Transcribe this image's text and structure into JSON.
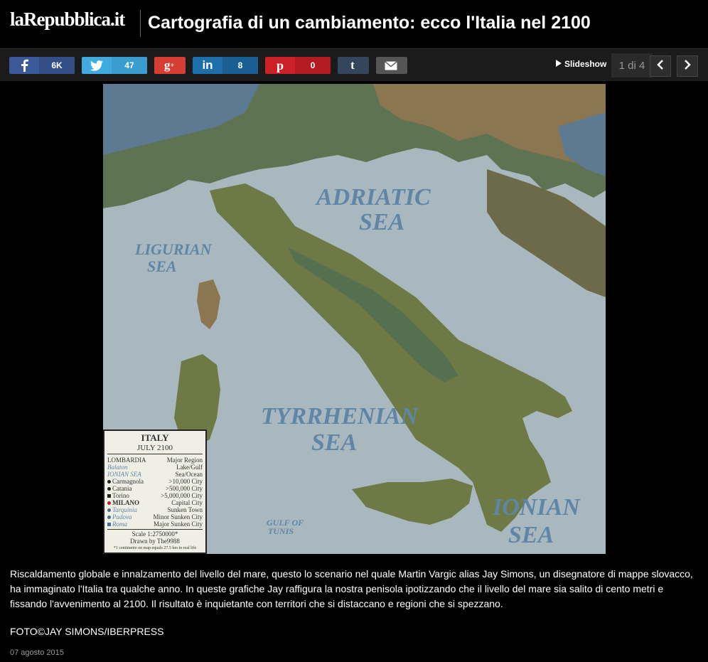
{
  "header": {
    "logo": "laRepubblica.it",
    "title": "Cartografia di un cambiamento: ecco l'Italia nel 2100"
  },
  "share": {
    "facebook": {
      "icon": "facebook-icon",
      "count": "6K"
    },
    "twitter": {
      "icon": "twitter-icon",
      "count": "47"
    },
    "googleplus": {
      "icon": "google-plus-icon"
    },
    "linkedin": {
      "icon": "linkedin-icon",
      "count": "8"
    },
    "pinterest": {
      "icon": "pinterest-icon",
      "count": "0"
    },
    "tumblr": {
      "icon": "tumblr-icon"
    },
    "email": {
      "icon": "email-icon"
    }
  },
  "gallery": {
    "slideshow_label": "Slideshow",
    "position": "1 di 4"
  },
  "map": {
    "sea_labels": [
      "ADRIATIC",
      "SEA",
      "LIGURIAN",
      "SEA",
      "TYRRHENIAN",
      "SEA",
      "IONIAN",
      "SEA",
      "GULF OF",
      "TUNIS"
    ],
    "legend": {
      "title": "ITALY",
      "subtitle": "JULY 2100",
      "rows": [
        {
          "left": "LOMBARDIA",
          "right": "Major Region"
        },
        {
          "left": "Balaton",
          "right": "Lake/Gulf"
        },
        {
          "left": "IONIAN SEA",
          "right": "Sea/Ocean"
        },
        {
          "left": "Carmagnola",
          "right": ">10,000 City"
        },
        {
          "left": "Catania",
          "right": ">500,000 City"
        },
        {
          "left": "Torino",
          "right": ">5,000,000 City"
        },
        {
          "left": "MILANO",
          "right": "Capital City"
        },
        {
          "left": "Tarquinia",
          "right": "Sunken Town"
        },
        {
          "left": "Padova",
          "right": "Minor Sunken City"
        },
        {
          "left": "Roma",
          "right": "Major Sunken City"
        }
      ],
      "scale": "Scale 1:2750000*",
      "drawn_by": "Drawn by The9988",
      "note": "*1 centimetre on map equals 27.5 km in real life"
    },
    "colors": {
      "sea": "#a9b8bf",
      "land_olive": "#6e7a45",
      "land_green": "#56704f",
      "land_brown": "#8a7650",
      "land_blue": "#5d7a93"
    }
  },
  "article": {
    "description": "Riscaldamento globale e innalzamento del livello del mare, questo lo scenario nel quale Martin Vargic alias Jay Simons, un disegnatore di mappe slovacco, ha immaginato l'Italia tra qualche anno. In queste grafiche Jay raffigura la nostra penisola ipotizzando che il livello del mare sia salito di cento metri e  fissando l'avvenimento al 2100. Il risultato è inquietante con territori che si distaccano e regioni che si spezzano.",
    "credit": "FOTO©JAY SIMONS/IBERPRESS",
    "date": "07 agosto 2015"
  }
}
